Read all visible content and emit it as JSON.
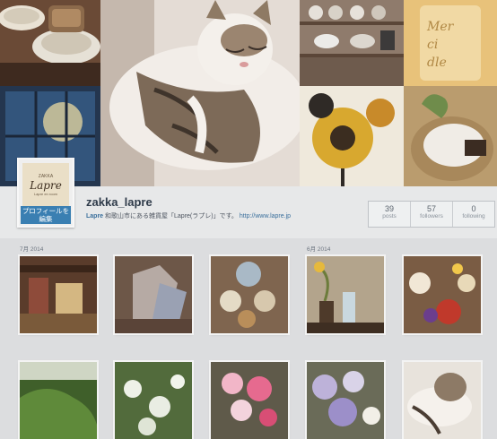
{
  "profile": {
    "username": "zakka_lapre",
    "bio_name": "Lapre",
    "bio_text": "和歌山市にある雑貨屋「Lapre(ラプレ)」です。",
    "bio_url": "http://www.lapre.jp",
    "edit_profile_label": "プロフィールを編集",
    "avatar_logo": {
      "small": "ZAKKA",
      "brand": "Lapre",
      "tiny": "Lapre en room"
    }
  },
  "stats": [
    {
      "value": "39",
      "label": "posts"
    },
    {
      "value": "57",
      "label": "followers"
    },
    {
      "value": "0",
      "label": "following"
    }
  ],
  "feed": {
    "month_labels": [
      "7月 2014",
      "6月 2014"
    ]
  },
  "colors": {
    "accent_button": "#3a7fb2",
    "link": "#3a6f9c",
    "username": "#2f3b4a"
  }
}
